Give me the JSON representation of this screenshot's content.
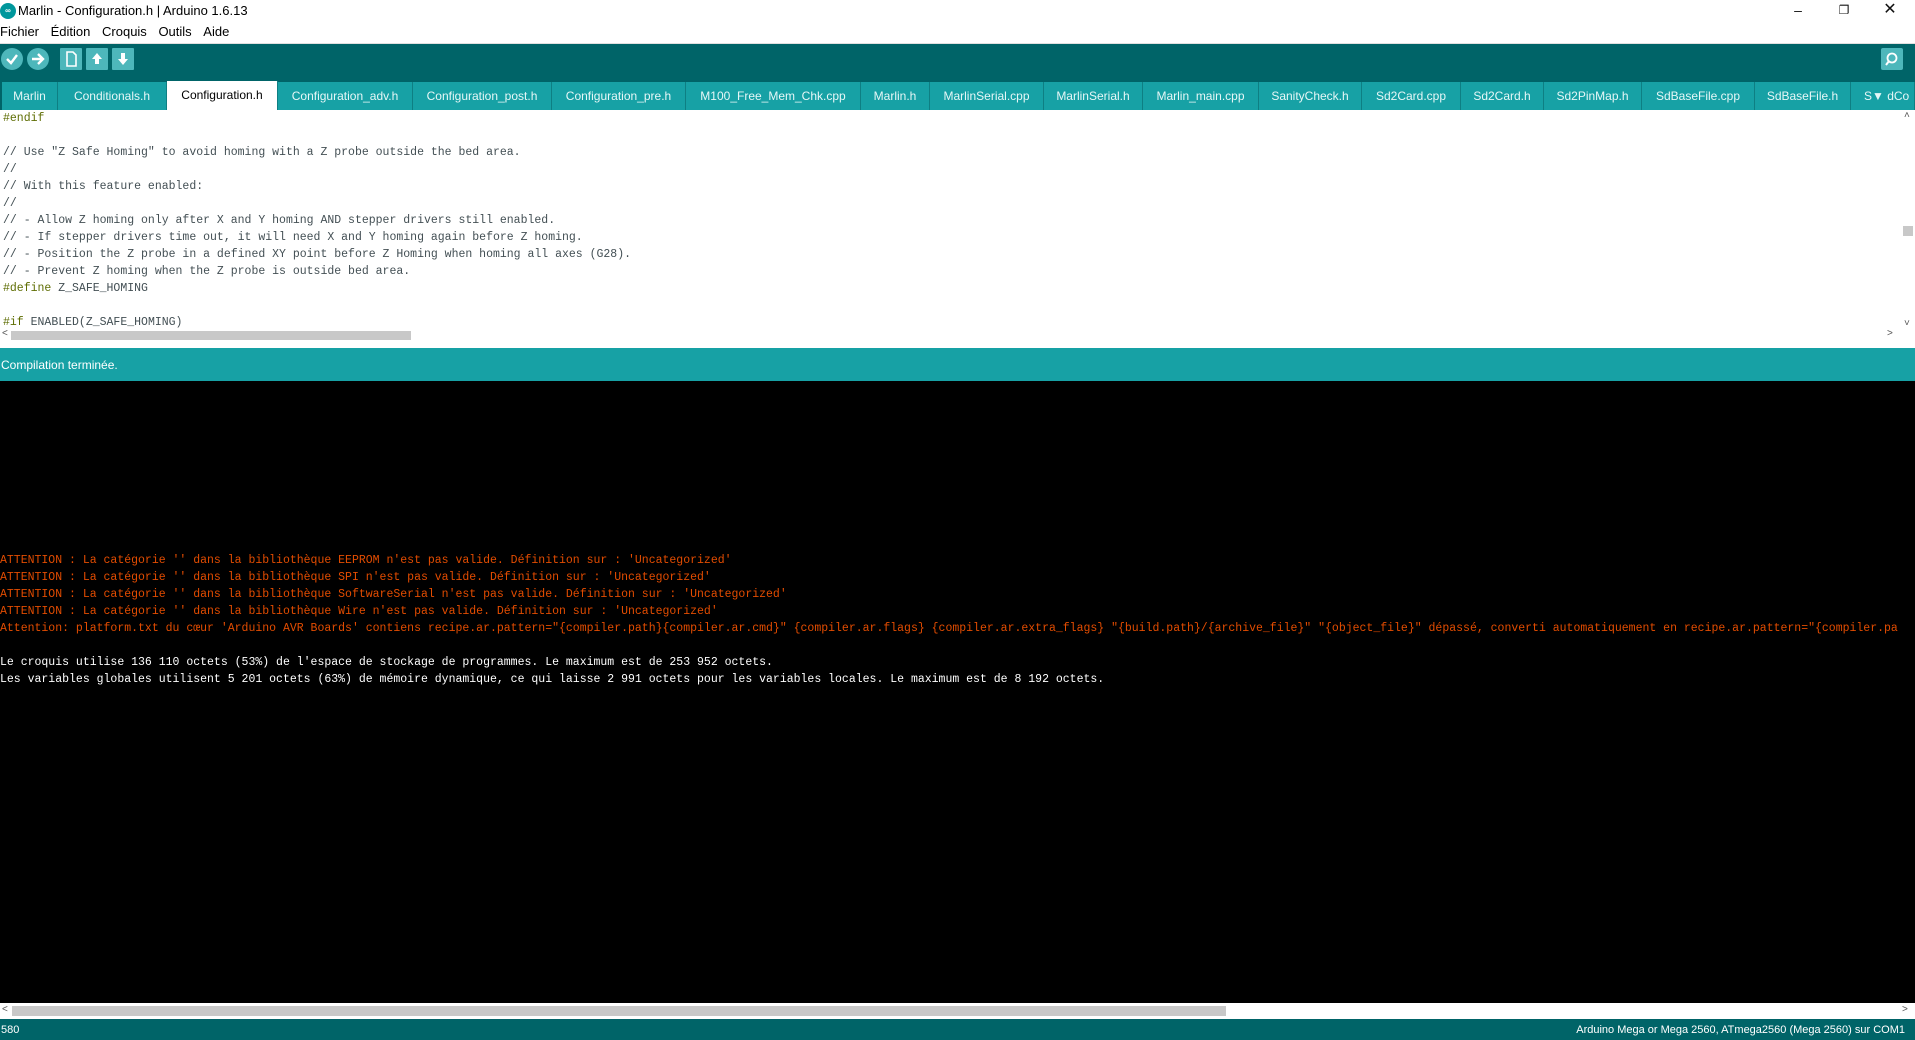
{
  "window": {
    "title": "Marlin - Configuration.h | Arduino 1.6.13",
    "app_icon": "arduino-logo-icon",
    "controls": [
      "minimize-icon",
      "restore-icon",
      "close-icon"
    ]
  },
  "menu": [
    "Fichier",
    "Édition",
    "Croquis",
    "Outils",
    "Aide"
  ],
  "toolbar": {
    "buttons": [
      "verify-icon",
      "upload-icon",
      "new-icon",
      "open-icon",
      "save-icon"
    ],
    "right_button": "serial-monitor-icon"
  },
  "tabs": [
    {
      "label": "Marlin"
    },
    {
      "label": "Conditionals.h"
    },
    {
      "label": "Configuration.h",
      "active": true
    },
    {
      "label": "Configuration_adv.h"
    },
    {
      "label": "Configuration_post.h"
    },
    {
      "label": "Configuration_pre.h"
    },
    {
      "label": "M100_Free_Mem_Chk.cpp"
    },
    {
      "label": "Marlin.h"
    },
    {
      "label": "MarlinSerial.cpp"
    },
    {
      "label": "MarlinSerial.h"
    },
    {
      "label": "Marlin_main.cpp"
    },
    {
      "label": "SanityCheck.h"
    },
    {
      "label": "Sd2Card.cpp"
    },
    {
      "label": "Sd2Card.h"
    },
    {
      "label": "Sd2PinMap.h"
    },
    {
      "label": "SdBaseFile.cpp"
    },
    {
      "label": "SdBaseFile.h"
    },
    {
      "label": "S▼ dCo"
    }
  ],
  "editor": {
    "lines": [
      {
        "kw": "#endif",
        "text": ""
      },
      {
        "kw": "",
        "text": ""
      },
      {
        "kw": "",
        "text": "// Use \"Z Safe Homing\" to avoid homing with a Z probe outside the bed area."
      },
      {
        "kw": "",
        "text": "//"
      },
      {
        "kw": "",
        "text": "// With this feature enabled:"
      },
      {
        "kw": "",
        "text": "//"
      },
      {
        "kw": "",
        "text": "// - Allow Z homing only after X and Y homing AND stepper drivers still enabled."
      },
      {
        "kw": "",
        "text": "// - If stepper drivers time out, it will need X and Y homing again before Z homing."
      },
      {
        "kw": "",
        "text": "// - Position the Z probe in a defined XY point before Z Homing when homing all axes (G28)."
      },
      {
        "kw": "",
        "text": "// - Prevent Z homing when the Z probe is outside bed area."
      },
      {
        "kw": "#define",
        "text": " Z_SAFE_HOMING"
      },
      {
        "kw": "",
        "text": ""
      },
      {
        "kw": "#if",
        "text": " ENABLED(Z_SAFE_HOMING)"
      }
    ]
  },
  "status": {
    "message": "Compilation terminée."
  },
  "console": {
    "warnings": [
      "ATTENTION : La catégorie '' dans la bibliothèque EEPROM n'est pas valide. Définition sur : 'Uncategorized'",
      "ATTENTION : La catégorie '' dans la bibliothèque SPI n'est pas valide. Définition sur : 'Uncategorized'",
      "ATTENTION : La catégorie '' dans la bibliothèque SoftwareSerial n'est pas valide. Définition sur : 'Uncategorized'",
      "ATTENTION : La catégorie '' dans la bibliothèque Wire n'est pas valide. Définition sur : 'Uncategorized'",
      "Attention: platform.txt du cœur 'Arduino AVR Boards' contiens recipe.ar.pattern=\"{compiler.path}{compiler.ar.cmd}\" {compiler.ar.flags} {compiler.ar.extra_flags} \"{build.path}/{archive_file}\" \"{object_file}\" dépassé, converti automatiquement en recipe.ar.pattern=\"{compiler.pa"
    ],
    "info": [
      "Le croquis utilise 136 110 octets (53%) de l'espace de stockage de programmes. Le maximum est de 253 952 octets.",
      "Les variables globales utilisent 5 201 octets (63%) de mémoire dynamique, ce qui laisse 2 991 octets pour les variables locales. Le maximum est de 8 192 octets."
    ]
  },
  "footer": {
    "line_number": "580",
    "board": "Arduino Mega or Mega 2560, ATmega2560 (Mega 2560) sur COM1"
  },
  "colors": {
    "teal_dark": "#006468",
    "teal_light": "#17a1a5",
    "warning": "#e34c00"
  }
}
